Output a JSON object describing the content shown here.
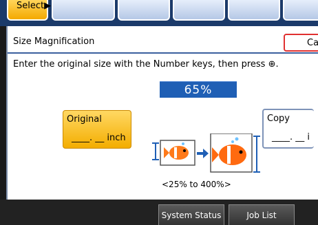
{
  "top_tabs": {
    "select_label": "Select▶"
  },
  "header": {
    "title": "Size Magnification",
    "cancel_label": "Ca"
  },
  "instruction": "Enter the original size with the Number keys, then press ⊕.",
  "magnification": {
    "percent": "65%",
    "range": "<25% to 400%>"
  },
  "original": {
    "label": "Original",
    "value": "____. __ inch"
  },
  "copy": {
    "label": "Copy",
    "value": "____. __ i"
  },
  "bottom_bar": {
    "system_status": "System Status",
    "job_list": "Job List"
  },
  "colors": {
    "accent_blue": "#1f5fb5",
    "selected_orange": "#f4a900",
    "cancel_border": "#e03030"
  },
  "icons": [
    "fish-original-icon",
    "fish-copy-icon",
    "arrow-right-icon"
  ]
}
